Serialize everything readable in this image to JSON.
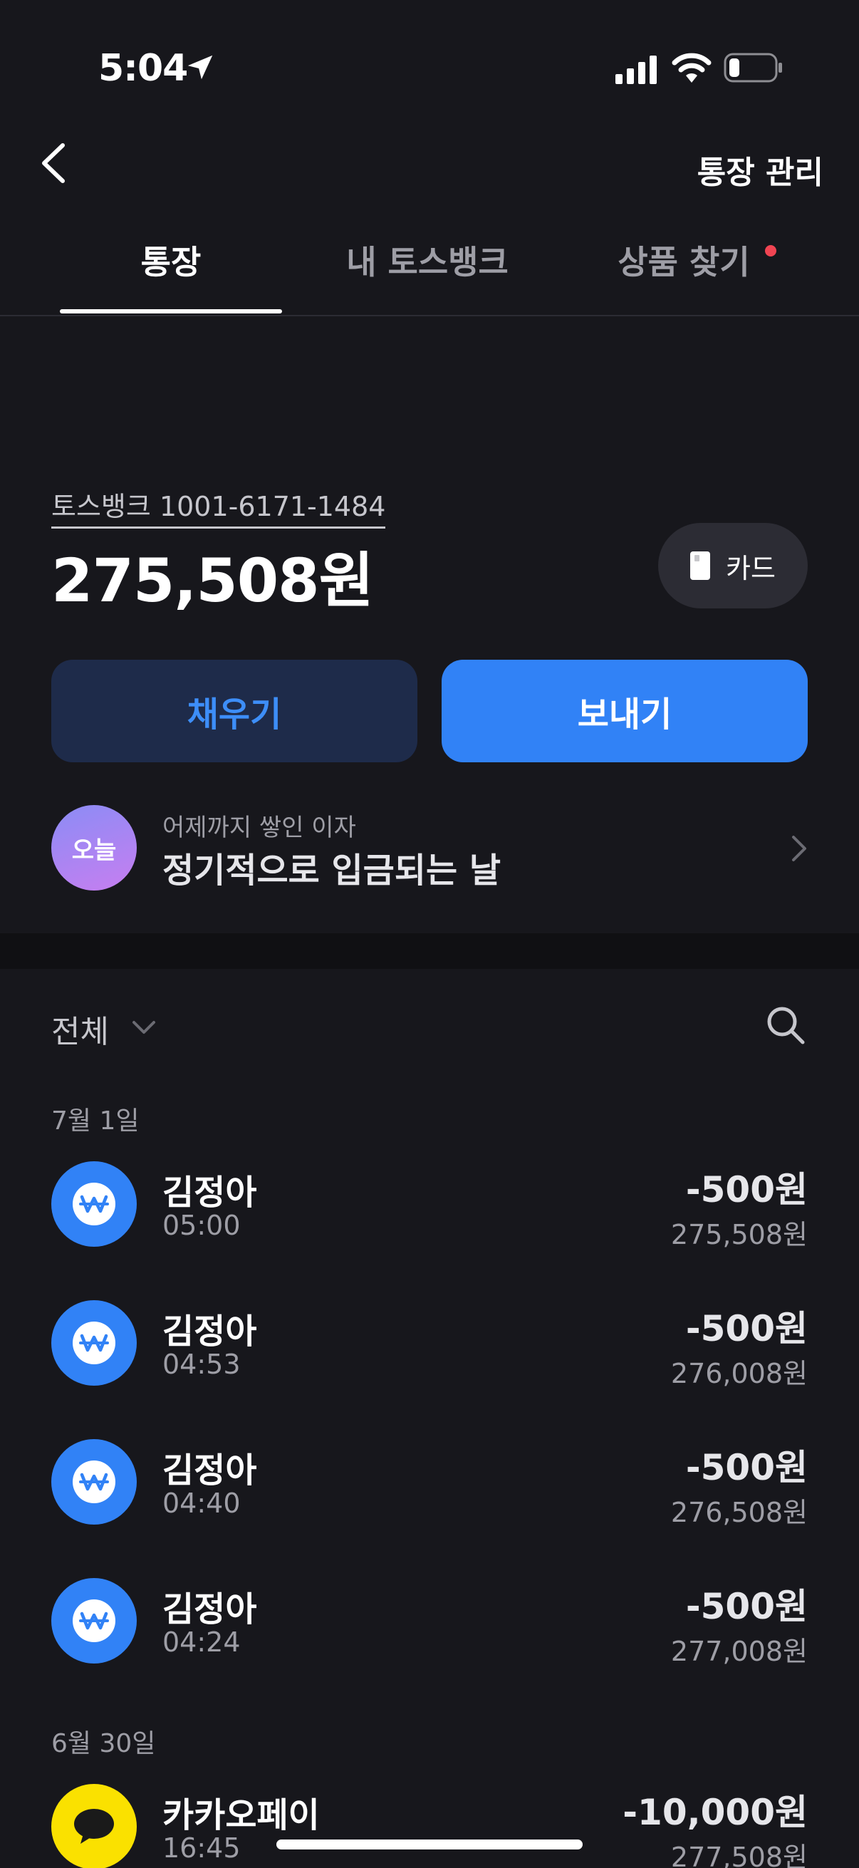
{
  "status_bar": {
    "time": "5:04"
  },
  "header": {
    "manage_label": "통장 관리"
  },
  "tabs": [
    {
      "label": "통장"
    },
    {
      "label": "내 토스뱅크"
    },
    {
      "label": "상품 찾기"
    }
  ],
  "account": {
    "name": "토스뱅크 1001-6171-1484",
    "balance": "275,508원",
    "card_label": "카드",
    "fill_label": "채우기",
    "send_label": "보내기"
  },
  "interest": {
    "badge": "오늘",
    "subtitle": "어제까지 쌓인 이자",
    "title": "정기적으로 입금되는 날"
  },
  "filter": {
    "label": "전체"
  },
  "groups": [
    {
      "date": "7월 1일",
      "transactions": [
        {
          "name": "김정아",
          "time": "05:00",
          "amount": "-500원",
          "balance": "275,508원",
          "icon": "won-transfer-icon"
        },
        {
          "name": "김정아",
          "time": "04:53",
          "amount": "-500원",
          "balance": "276,008원",
          "icon": "won-transfer-icon"
        },
        {
          "name": "김정아",
          "time": "04:40",
          "amount": "-500원",
          "balance": "276,508원",
          "icon": "won-transfer-icon"
        },
        {
          "name": "김정아",
          "time": "04:24",
          "amount": "-500원",
          "balance": "277,008원",
          "icon": "won-transfer-icon"
        }
      ]
    },
    {
      "date": "6월 30일",
      "transactions": [
        {
          "name": "카카오페이",
          "time": "16:45",
          "amount": "-10,000원",
          "balance": "277,508원",
          "icon": "kakao-speech-icon"
        }
      ]
    }
  ],
  "colors": {
    "background": "#17171c",
    "accent": "#3182f6",
    "tab_dot": "#f04452",
    "kakao": "#fae100"
  }
}
